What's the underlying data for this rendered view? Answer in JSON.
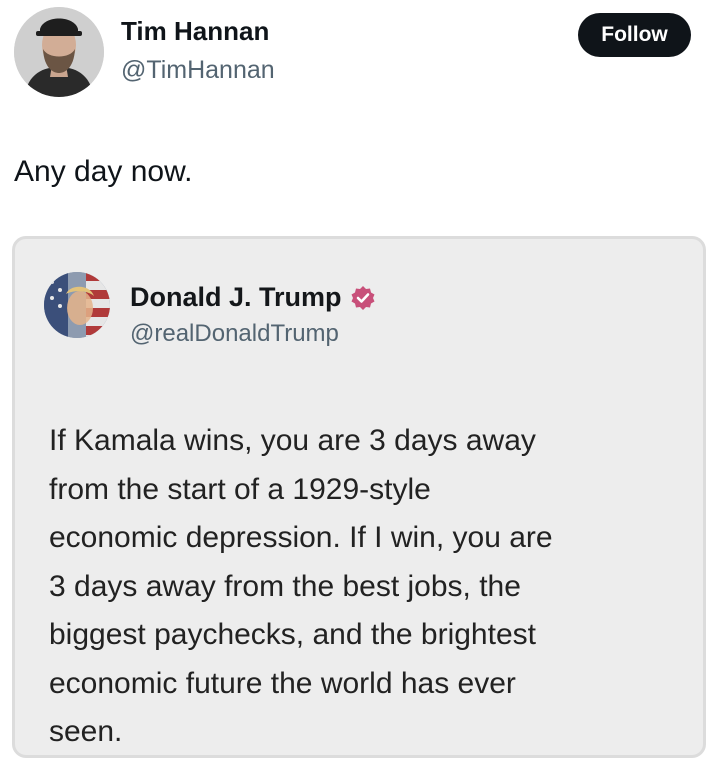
{
  "author": {
    "display_name": "Tim Hannan",
    "handle": "@TimHannan",
    "avatar_icon": "user-photo-avatar"
  },
  "actions": {
    "follow_label": "Follow"
  },
  "tweet": {
    "text": "Any day now."
  },
  "quoted_post": {
    "display_name": "Donald J. Trump",
    "handle": "@realDonaldTrump",
    "verified_icon": "verified-badge-icon",
    "verified_color": "#c8507a",
    "body_lines": [
      "If Kamala wins, you are 3 days away",
      "from the start of a 1929-style",
      "economic depression. If I win, you are",
      "3 days away from the best jobs, the",
      "biggest paychecks, and the brightest",
      "economic future the world has ever",
      "seen."
    ]
  },
  "colors": {
    "follow_bg": "#0f1419",
    "card_bg": "#ededed",
    "secondary_text": "#536471"
  }
}
